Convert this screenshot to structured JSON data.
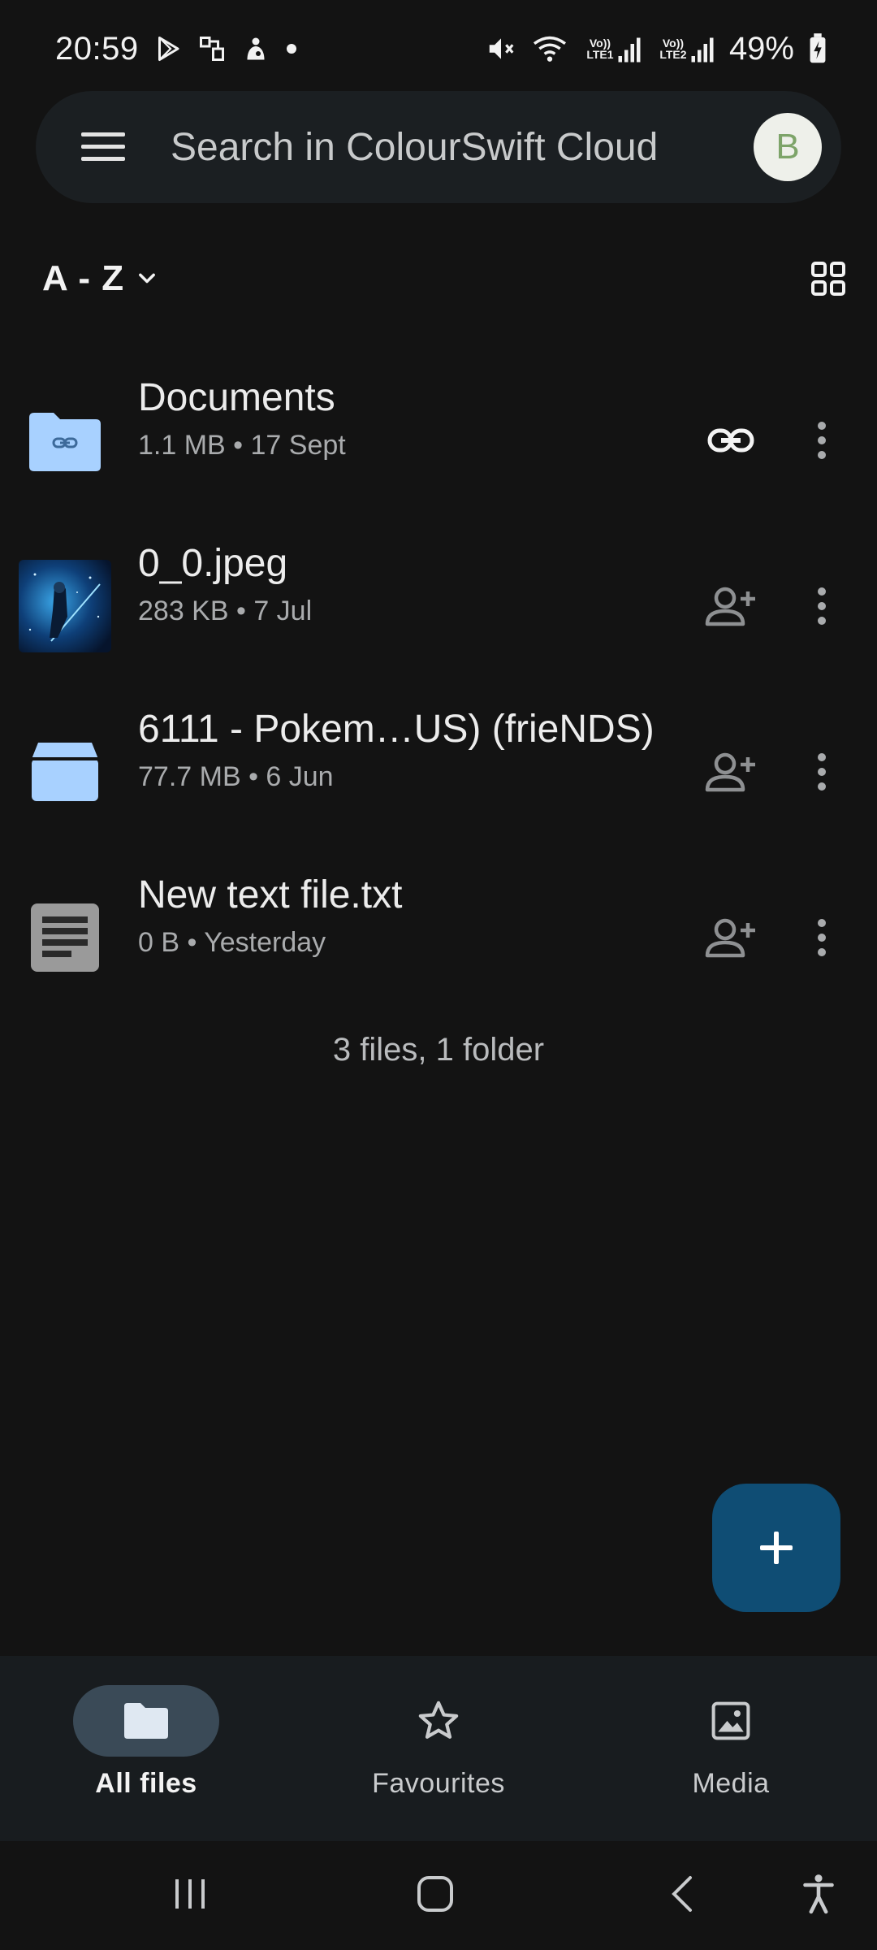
{
  "status_bar": {
    "time": "20:59",
    "battery_percent": "49%",
    "sim1_label": "Vo)) LTE1",
    "sim2_label": "Vo)) LTE2"
  },
  "search": {
    "placeholder": "Search in ColourSwift Cloud",
    "avatar_letter": "B"
  },
  "sort": {
    "label": "A - Z"
  },
  "files": [
    {
      "name": "Documents",
      "meta": "1.1 MB • 17 Sept",
      "type": "shared-folder",
      "action_icon": "link-icon"
    },
    {
      "name": "0_0.jpeg",
      "meta": "283 KB • 7 Jul",
      "type": "image",
      "action_icon": "add-person-icon"
    },
    {
      "name": "6111 - Pokem…US) (frieNDS)",
      "meta": "77.7 MB • 6 Jun",
      "type": "archive",
      "action_icon": "add-person-icon"
    },
    {
      "name": "New text file.txt",
      "meta": "0 B • Yesterday",
      "type": "text",
      "action_icon": "add-person-icon"
    }
  ],
  "summary": "3 files, 1 folder",
  "bottom_nav": {
    "items": [
      {
        "label": "All files",
        "icon": "folder-icon",
        "active": true
      },
      {
        "label": "Favourites",
        "icon": "star-icon",
        "active": false
      },
      {
        "label": "Media",
        "icon": "image-icon",
        "active": false
      }
    ]
  },
  "colors": {
    "background": "#131313",
    "surface": "#1b1f22",
    "folder": "#a8d1ff",
    "fab": "#0f4d74",
    "nav_active_pill": "#3a4a57"
  }
}
